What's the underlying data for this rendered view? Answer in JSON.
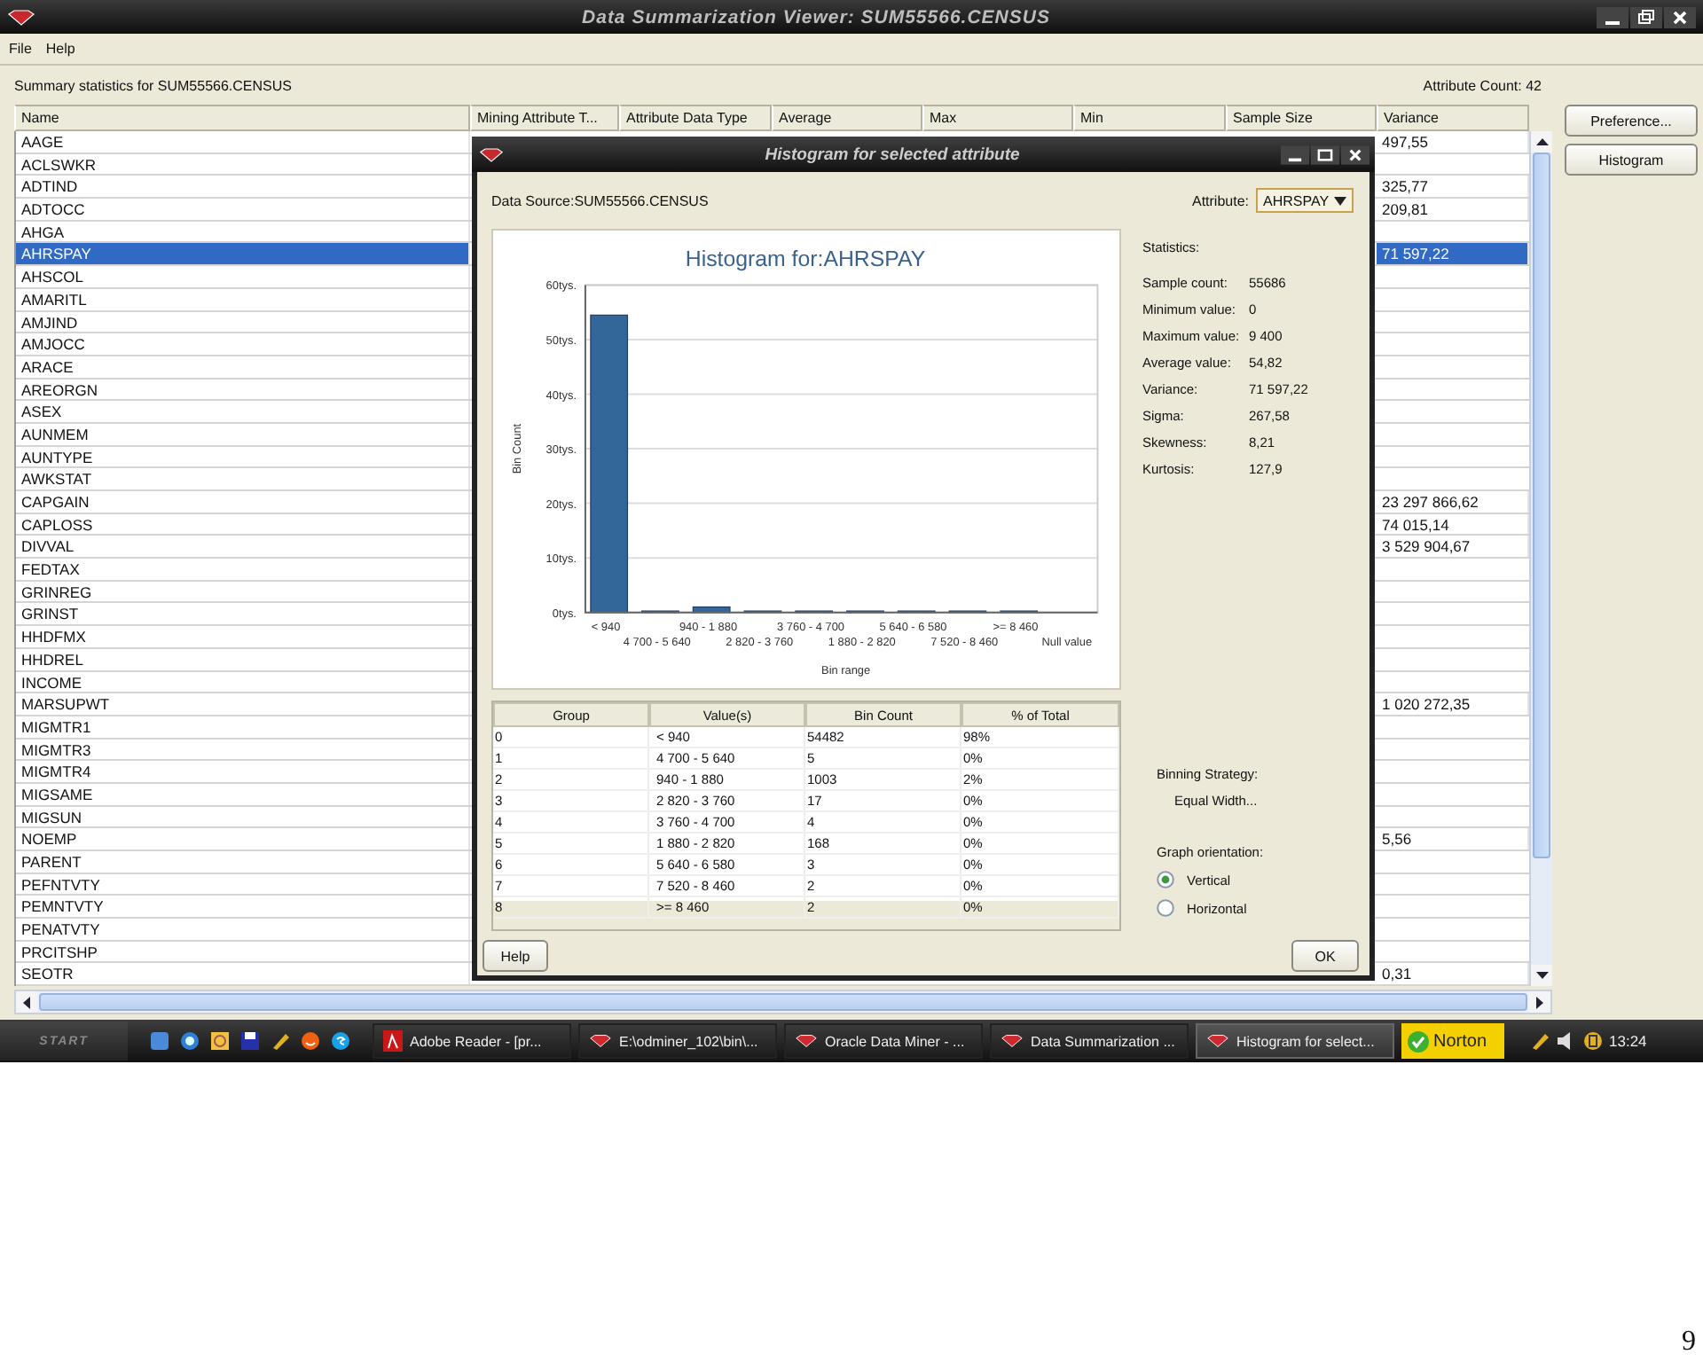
{
  "window": {
    "title": "Data Summarization Viewer: SUM55566.CENSUS"
  },
  "menu": [
    "File",
    "Help"
  ],
  "summary": {
    "caption": "Summary statistics for SUM55566.CENSUS",
    "attribute_count": "Attribute Count: 42"
  },
  "table": {
    "columns": [
      "Name",
      "Mining Attribute T...",
      "Attribute Data Type",
      "Average",
      "Max",
      "Min",
      "Sample Size",
      "Variance"
    ],
    "rows": [
      {
        "name": "AAGE",
        "variance": "497,55",
        "selected": false
      },
      {
        "name": "ACLSWKR",
        "selected": false
      },
      {
        "name": "ADTIND",
        "variance": "325,77",
        "selected": false
      },
      {
        "name": "ADTOCC",
        "variance": "209,81",
        "selected": false
      },
      {
        "name": "AHGA",
        "selected": false
      },
      {
        "name": "AHRSPAY",
        "variance": "71 597,22",
        "selected": true
      },
      {
        "name": "AHSCOL",
        "selected": false
      },
      {
        "name": "AMARITL",
        "selected": false
      },
      {
        "name": "AMJIND",
        "selected": false
      },
      {
        "name": "AMJOCC",
        "selected": false
      },
      {
        "name": "ARACE",
        "selected": false
      },
      {
        "name": "AREORGN",
        "selected": false
      },
      {
        "name": "ASEX",
        "selected": false
      },
      {
        "name": "AUNMEM",
        "selected": false
      },
      {
        "name": "AUNTYPE",
        "selected": false
      },
      {
        "name": "AWKSTAT",
        "selected": false
      },
      {
        "name": "CAPGAIN",
        "variance": "23 297 866,62",
        "selected": false
      },
      {
        "name": "CAPLOSS",
        "variance": "74 015,14",
        "selected": false
      },
      {
        "name": "DIVVAL",
        "variance": "3 529 904,67",
        "selected": false
      },
      {
        "name": "FEDTAX",
        "selected": false
      },
      {
        "name": "GRINREG",
        "selected": false
      },
      {
        "name": "GRINST",
        "selected": false
      },
      {
        "name": "HHDFMX",
        "selected": false
      },
      {
        "name": "HHDREL",
        "selected": false
      },
      {
        "name": "INCOME",
        "selected": false
      },
      {
        "name": "MARSUPWT",
        "variance": "1 020 272,35",
        "selected": false
      },
      {
        "name": "MIGMTR1",
        "selected": false
      },
      {
        "name": "MIGMTR3",
        "selected": false
      },
      {
        "name": "MIGMTR4",
        "selected": false
      },
      {
        "name": "MIGSAME",
        "selected": false
      },
      {
        "name": "MIGSUN",
        "selected": false
      },
      {
        "name": "NOEMP",
        "variance": "5,56",
        "selected": false
      },
      {
        "name": "PARENT",
        "selected": false
      },
      {
        "name": "PEFNTVTY",
        "selected": false
      },
      {
        "name": "PEMNTVTY",
        "selected": false
      },
      {
        "name": "PENATVTY",
        "selected": false
      },
      {
        "name": "PRCITSHP",
        "selected": false
      },
      {
        "name": "SEOTR",
        "variance": "0,31",
        "selected": false
      }
    ]
  },
  "buttons": [
    "Preference...",
    "Histogram"
  ],
  "dialog": {
    "title": "Histogram for selected attribute",
    "data_source": "Data Source:SUM55566.CENSUS",
    "attribute_label": "Attribute:",
    "attribute_value": "AHRSPAY",
    "chart_data": {
      "type": "bar",
      "title": "Histogram for:AHRSPAY",
      "xlabel": "Bin range",
      "ylabel": "Bin Count",
      "categories": [
        "< 940",
        "4 700 - 5 640",
        "940 - 1 880",
        "2 820 - 3 760",
        "3 760 - 4 700",
        "1 880 - 2 820",
        "5 640 - 6 580",
        "7 520 - 8 460",
        ">= 8 460",
        "Null value"
      ],
      "values": [
        54.5,
        0,
        1,
        0,
        0,
        0.2,
        0,
        0,
        0,
        null
      ],
      "ylim": [
        0,
        60
      ],
      "grid": true,
      "yticks": [
        {
          "value": 0,
          "label": "0tys."
        },
        {
          "value": 10,
          "label": "10tys."
        },
        {
          "value": 20,
          "label": "20tys."
        },
        {
          "value": 30,
          "label": "30tys."
        },
        {
          "value": 40,
          "label": "40tys."
        },
        {
          "value": 50,
          "label": "50tys."
        },
        {
          "value": 60,
          "label": "60tys."
        }
      ]
    },
    "bin_table": {
      "columns": [
        "Group",
        "Value(s)",
        "Bin Count",
        "% of Total"
      ],
      "rows": [
        [
          "0",
          "< 940",
          "54482",
          "98%"
        ],
        [
          "1",
          "4 700 - 5 640",
          "5",
          "0%"
        ],
        [
          "2",
          "940 - 1 880",
          "1003",
          "2%"
        ],
        [
          "3",
          "2 820 - 3 760",
          "17",
          "0%"
        ],
        [
          "4",
          "3 760 - 4 700",
          "4",
          "0%"
        ],
        [
          "5",
          "1 880 - 2 820",
          "168",
          "0%"
        ],
        [
          "6",
          "5 640 - 6 580",
          "3",
          "0%"
        ],
        [
          "7",
          "7 520 - 8 460",
          "2",
          "0%"
        ],
        [
          "8",
          ">= 8 460",
          "2",
          "0%"
        ]
      ]
    },
    "statistics": {
      "heading": "Statistics:",
      "rows": [
        {
          "label": "Sample count:",
          "value": "55686"
        },
        {
          "label": "Minimum value:",
          "value": "0"
        },
        {
          "label": "Maximum value:",
          "value": "9 400"
        },
        {
          "label": "Average value:",
          "value": "54,82"
        },
        {
          "label": "Variance:",
          "value": "71 597,22"
        },
        {
          "label": "Sigma:",
          "value": "267,58"
        },
        {
          "label": "Skewness:",
          "value": "8,21"
        },
        {
          "label": "Kurtosis:",
          "value": "127,9"
        }
      ]
    },
    "binning": {
      "label": "Binning Strategy:",
      "value": "Equal Width..."
    },
    "orientation": {
      "label": "Graph orientation:",
      "options": [
        {
          "label": "Vertical",
          "selected": true
        },
        {
          "label": "Horizontal",
          "selected": false
        }
      ]
    },
    "help_button": "Help",
    "ok_button": "OK"
  },
  "taskbar": {
    "start": "START",
    "tasks": [
      {
        "label": "Adobe Reader - [pr...",
        "kind": "adobe",
        "selected": false
      },
      {
        "label": "E:\\odminer_102\\bin\\...",
        "kind": "oracle",
        "selected": false
      },
      {
        "label": "Oracle Data Miner - ...",
        "kind": "oracle",
        "selected": false
      },
      {
        "label": "Data Summarization ...",
        "kind": "oracle",
        "selected": false
      },
      {
        "label": "Histogram for select...",
        "kind": "oracle",
        "selected": true
      }
    ],
    "norton": "Norton",
    "clock": "13:24"
  },
  "page_number": "9"
}
